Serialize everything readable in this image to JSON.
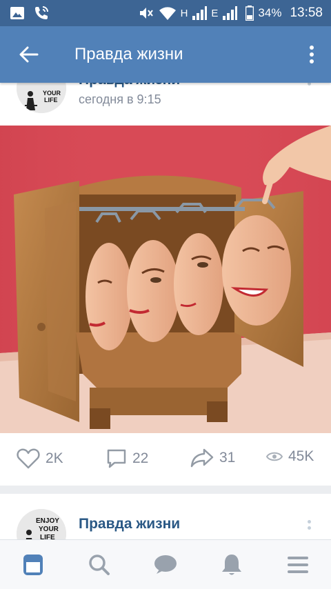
{
  "status_bar": {
    "network_h": "H",
    "network_e": "E",
    "battery": "34%",
    "time": "13:58"
  },
  "header": {
    "title": "Правда жизни"
  },
  "post1": {
    "author": "Правда жизни",
    "time": "сегодня в 9:15",
    "avatar_text": [
      "YOUR",
      "LIFE"
    ],
    "likes": "2K",
    "comments": "22",
    "shares": "31",
    "views": "45K"
  },
  "post2": {
    "author": "Правда жизни",
    "avatar_text": [
      "ENJOY",
      "YOUR",
      "LIFE"
    ]
  },
  "nav": {
    "items": [
      "news-icon",
      "search-icon",
      "messages-icon",
      "notifications-icon",
      "menu-icon"
    ],
    "active": "news-icon"
  },
  "colors": {
    "statusbar": "#3d6594",
    "header": "#5181b8",
    "link": "#2a5885",
    "muted": "#828a99",
    "active_nav": "#5181b8"
  }
}
